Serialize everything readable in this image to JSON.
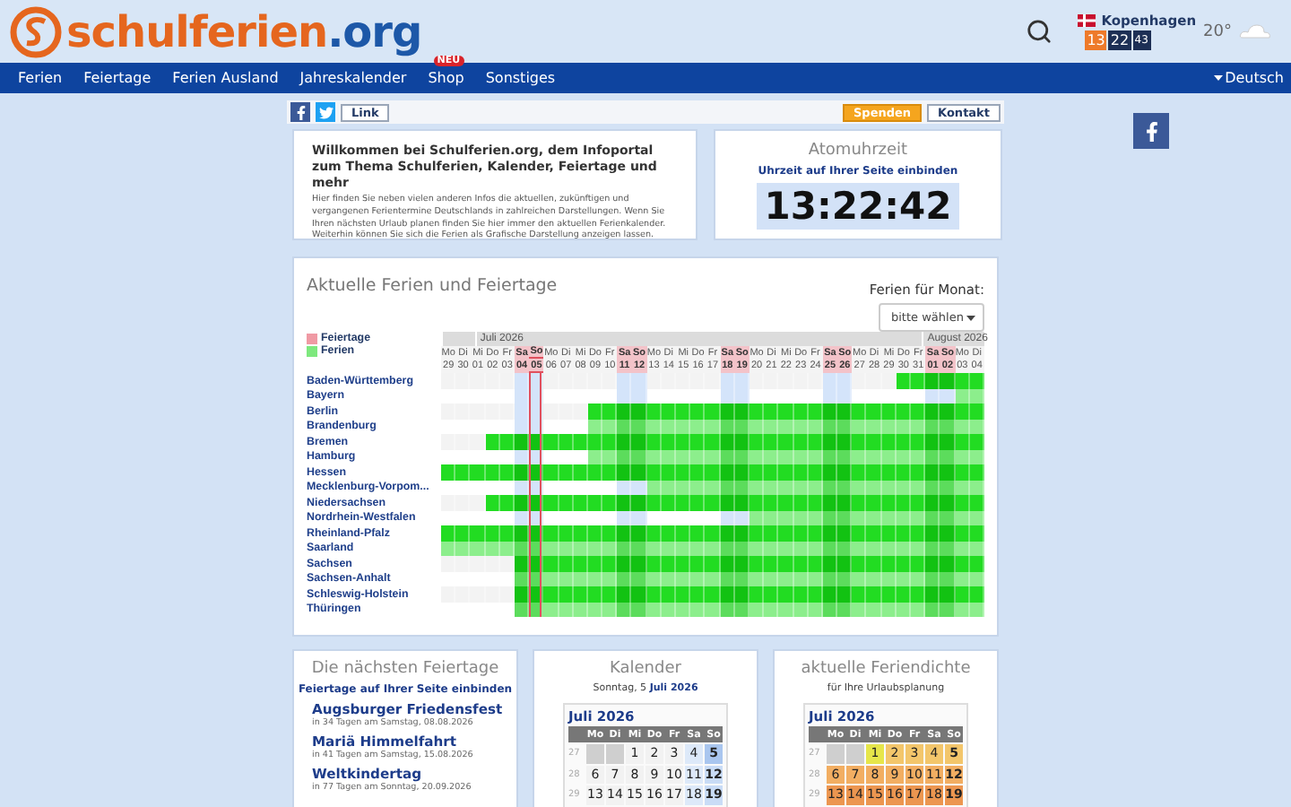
{
  "header": {
    "logo_name": "schulferien",
    "logo_tld": ".org",
    "weather": {
      "city": "Kopenhagen",
      "hours": "13",
      "minutes": "22",
      "seconds": "43",
      "temperature": "20°"
    }
  },
  "nav": {
    "items": [
      {
        "label": "Ferien"
      },
      {
        "label": "Feiertage"
      },
      {
        "label": "Ferien Ausland"
      },
      {
        "label": "Jahreskalender"
      },
      {
        "label": "Shop",
        "badge": "NEU"
      },
      {
        "label": "Sonstiges"
      }
    ],
    "language": "Deutsch"
  },
  "toolbar": {
    "link": "Link",
    "donate": "Spenden",
    "contact": "Kontakt"
  },
  "welcome": {
    "title": "Willkommen bei Schulferien.org, dem Infoportal zum Thema Schulferien, Kalender, Feiertage und mehr",
    "text": "Hier finden Sie neben vielen anderen Infos die aktuellen, zukünftigen und vergangenen Ferientermine Deutschlands in zahlreichen Darstellungen. Wenn Sie Ihren nächsten Urlaub planen finden Sie hier immer den aktuellen Ferienkalender. Weiterhin können Sie sich die Ferien als Grafische Darstellung anzeigen lassen."
  },
  "clock": {
    "title": "Atomuhrzeit",
    "embed_link": "Uhrzeit auf Ihrer Seite einbinden",
    "time": "13:22:42"
  },
  "holidays_map": {
    "title": "Aktuelle Ferien und Feiertage",
    "month_label": "Ferien für Monat:",
    "month_select": {
      "placeholder": "bitte wählen"
    },
    "legend": [
      {
        "label": "Feiertage",
        "color": "#f09aa4"
      },
      {
        "label": "Ferien",
        "color": "#7ee87e"
      }
    ],
    "days": [
      {
        "weekday": "Mo",
        "day": "29",
        "weekend": false,
        "today": false
      },
      {
        "weekday": "Di",
        "day": "30",
        "weekend": false,
        "today": false
      },
      {
        "weekday": "Mi",
        "day": "01",
        "weekend": false,
        "today": false,
        "month_label": "Juli 2026"
      },
      {
        "weekday": "Do",
        "day": "02",
        "weekend": false,
        "today": false
      },
      {
        "weekday": "Fr",
        "day": "03",
        "weekend": false,
        "today": false
      },
      {
        "weekday": "Sa",
        "day": "04",
        "weekend": true,
        "today": false
      },
      {
        "weekday": "So",
        "day": "05",
        "weekend": true,
        "today": true
      },
      {
        "weekday": "Mo",
        "day": "06",
        "weekend": false,
        "today": false
      },
      {
        "weekday": "Di",
        "day": "07",
        "weekend": false,
        "today": false
      },
      {
        "weekday": "Mi",
        "day": "08",
        "weekend": false,
        "today": false
      },
      {
        "weekday": "Do",
        "day": "09",
        "weekend": false,
        "today": false
      },
      {
        "weekday": "Fr",
        "day": "10",
        "weekend": false,
        "today": false
      },
      {
        "weekday": "Sa",
        "day": "11",
        "weekend": true,
        "today": false
      },
      {
        "weekday": "So",
        "day": "12",
        "weekend": true,
        "today": false
      },
      {
        "weekday": "Mo",
        "day": "13",
        "weekend": false,
        "today": false
      },
      {
        "weekday": "Di",
        "day": "14",
        "weekend": false,
        "today": false
      },
      {
        "weekday": "Mi",
        "day": "15",
        "weekend": false,
        "today": false
      },
      {
        "weekday": "Do",
        "day": "16",
        "weekend": false,
        "today": false
      },
      {
        "weekday": "Fr",
        "day": "17",
        "weekend": false,
        "today": false
      },
      {
        "weekday": "Sa",
        "day": "18",
        "weekend": true,
        "today": false
      },
      {
        "weekday": "So",
        "day": "19",
        "weekend": true,
        "today": false
      },
      {
        "weekday": "Mo",
        "day": "20",
        "weekend": false,
        "today": false
      },
      {
        "weekday": "Di",
        "day": "21",
        "weekend": false,
        "today": false
      },
      {
        "weekday": "Mi",
        "day": "22",
        "weekend": false,
        "today": false
      },
      {
        "weekday": "Do",
        "day": "23",
        "weekend": false,
        "today": false
      },
      {
        "weekday": "Fr",
        "day": "24",
        "weekend": false,
        "today": false
      },
      {
        "weekday": "Sa",
        "day": "25",
        "weekend": true,
        "today": false
      },
      {
        "weekday": "So",
        "day": "26",
        "weekend": true,
        "today": false
      },
      {
        "weekday": "Mo",
        "day": "27",
        "weekend": false,
        "today": false
      },
      {
        "weekday": "Di",
        "day": "28",
        "weekend": false,
        "today": false
      },
      {
        "weekday": "Mi",
        "day": "29",
        "weekend": false,
        "today": false
      },
      {
        "weekday": "Do",
        "day": "30",
        "weekend": false,
        "today": false
      },
      {
        "weekday": "Fr",
        "day": "31",
        "weekend": false,
        "today": false
      },
      {
        "weekday": "Sa",
        "day": "01",
        "weekend": true,
        "today": false,
        "month_label": "August 2026"
      },
      {
        "weekday": "So",
        "day": "02",
        "weekend": true,
        "today": false
      },
      {
        "weekday": "Mo",
        "day": "03",
        "weekend": false,
        "today": false
      },
      {
        "weekday": "Di",
        "day": "04",
        "weekend": false,
        "today": false
      }
    ],
    "states": [
      {
        "name": "Baden-Württemberg",
        "ferien": [
          false,
          false,
          false,
          false,
          false,
          false,
          false,
          false,
          false,
          false,
          false,
          false,
          false,
          false,
          false,
          false,
          false,
          false,
          false,
          false,
          false,
          false,
          false,
          false,
          false,
          false,
          false,
          false,
          false,
          false,
          false,
          true,
          true,
          true,
          true,
          true,
          true
        ]
      },
      {
        "name": "Bayern",
        "ferien": [
          false,
          false,
          false,
          false,
          false,
          false,
          false,
          false,
          false,
          false,
          false,
          false,
          false,
          false,
          false,
          false,
          false,
          false,
          false,
          false,
          false,
          false,
          false,
          false,
          false,
          false,
          false,
          false,
          false,
          false,
          false,
          false,
          false,
          false,
          false,
          true,
          true
        ]
      },
      {
        "name": "Berlin",
        "ferien": [
          false,
          false,
          false,
          false,
          false,
          false,
          false,
          false,
          false,
          false,
          true,
          true,
          true,
          true,
          true,
          true,
          true,
          true,
          true,
          true,
          true,
          true,
          true,
          true,
          true,
          true,
          true,
          true,
          true,
          true,
          true,
          true,
          true,
          true,
          true,
          true,
          true
        ]
      },
      {
        "name": "Brandenburg",
        "ferien": [
          false,
          false,
          false,
          false,
          false,
          false,
          false,
          false,
          false,
          false,
          true,
          true,
          true,
          true,
          true,
          true,
          true,
          true,
          true,
          true,
          true,
          true,
          true,
          true,
          true,
          true,
          true,
          true,
          true,
          true,
          true,
          true,
          true,
          true,
          true,
          true,
          true
        ]
      },
      {
        "name": "Bremen",
        "ferien": [
          false,
          false,
          false,
          true,
          true,
          true,
          true,
          true,
          true,
          true,
          true,
          true,
          true,
          true,
          true,
          true,
          true,
          true,
          true,
          true,
          true,
          true,
          true,
          true,
          true,
          true,
          true,
          true,
          true,
          true,
          true,
          true,
          true,
          true,
          true,
          true,
          true
        ]
      },
      {
        "name": "Hamburg",
        "ferien": [
          false,
          false,
          false,
          false,
          false,
          false,
          false,
          false,
          false,
          false,
          true,
          true,
          true,
          true,
          true,
          true,
          true,
          true,
          true,
          true,
          true,
          true,
          true,
          true,
          true,
          true,
          true,
          true,
          true,
          true,
          true,
          true,
          true,
          true,
          true,
          true,
          true
        ]
      },
      {
        "name": "Hessen",
        "ferien": [
          true,
          true,
          true,
          true,
          true,
          true,
          true,
          true,
          true,
          true,
          true,
          true,
          true,
          true,
          true,
          true,
          true,
          true,
          true,
          true,
          true,
          true,
          true,
          true,
          true,
          true,
          true,
          true,
          true,
          true,
          true,
          true,
          true,
          true,
          true,
          true,
          true
        ]
      },
      {
        "name": "Mecklenburg-Vorpom...",
        "ferien": [
          false,
          false,
          false,
          false,
          false,
          false,
          false,
          false,
          false,
          false,
          false,
          false,
          false,
          false,
          true,
          true,
          true,
          true,
          true,
          true,
          true,
          true,
          true,
          true,
          true,
          true,
          true,
          true,
          true,
          true,
          true,
          true,
          true,
          true,
          true,
          true,
          true
        ]
      },
      {
        "name": "Niedersachsen",
        "ferien": [
          false,
          false,
          false,
          true,
          true,
          true,
          true,
          true,
          true,
          true,
          true,
          true,
          true,
          true,
          true,
          true,
          true,
          true,
          true,
          true,
          true,
          true,
          true,
          true,
          true,
          true,
          true,
          true,
          true,
          true,
          true,
          true,
          true,
          true,
          true,
          true,
          true
        ]
      },
      {
        "name": "Nordrhein-Westfalen",
        "ferien": [
          false,
          false,
          false,
          false,
          false,
          false,
          false,
          false,
          false,
          false,
          false,
          false,
          false,
          false,
          false,
          false,
          false,
          false,
          false,
          false,
          false,
          true,
          true,
          true,
          true,
          true,
          true,
          true,
          true,
          true,
          true,
          true,
          true,
          true,
          true,
          true,
          true
        ]
      },
      {
        "name": "Rheinland-Pfalz",
        "ferien": [
          true,
          true,
          true,
          true,
          true,
          true,
          true,
          true,
          true,
          true,
          true,
          true,
          true,
          true,
          true,
          true,
          true,
          true,
          true,
          true,
          true,
          true,
          true,
          true,
          true,
          true,
          true,
          true,
          true,
          true,
          true,
          true,
          true,
          true,
          true,
          true,
          true
        ]
      },
      {
        "name": "Saarland",
        "ferien": [
          true,
          true,
          true,
          true,
          true,
          true,
          true,
          true,
          true,
          true,
          true,
          true,
          true,
          true,
          true,
          true,
          true,
          true,
          true,
          true,
          true,
          true,
          true,
          true,
          true,
          true,
          true,
          true,
          true,
          true,
          true,
          true,
          true,
          true,
          true,
          true,
          true
        ]
      },
      {
        "name": "Sachsen",
        "ferien": [
          false,
          false,
          false,
          false,
          false,
          true,
          true,
          true,
          true,
          true,
          true,
          true,
          true,
          true,
          true,
          true,
          true,
          true,
          true,
          true,
          true,
          true,
          true,
          true,
          true,
          true,
          true,
          true,
          true,
          true,
          true,
          true,
          true,
          true,
          true,
          true,
          true
        ]
      },
      {
        "name": "Sachsen-Anhalt",
        "ferien": [
          false,
          false,
          false,
          false,
          false,
          true,
          true,
          true,
          true,
          true,
          true,
          true,
          true,
          true,
          true,
          true,
          true,
          true,
          true,
          true,
          true,
          true,
          true,
          true,
          true,
          true,
          true,
          true,
          true,
          true,
          true,
          true,
          true,
          true,
          true,
          true,
          true
        ]
      },
      {
        "name": "Schleswig-Holstein",
        "ferien": [
          false,
          false,
          false,
          false,
          false,
          true,
          true,
          true,
          true,
          true,
          true,
          true,
          true,
          true,
          true,
          true,
          true,
          true,
          true,
          true,
          true,
          true,
          true,
          true,
          true,
          true,
          true,
          true,
          true,
          true,
          true,
          true,
          true,
          true,
          true,
          true,
          true
        ]
      },
      {
        "name": "Thüringen",
        "ferien": [
          false,
          false,
          false,
          false,
          false,
          true,
          true,
          true,
          true,
          true,
          true,
          true,
          true,
          true,
          true,
          true,
          true,
          true,
          true,
          true,
          true,
          true,
          true,
          true,
          true,
          true,
          true,
          true,
          true,
          true,
          true,
          true,
          true,
          true,
          true,
          true,
          true
        ]
      }
    ]
  },
  "next_holidays": {
    "title": "Die nächsten Feiertage",
    "embed_link": "Feiertage auf Ihrer Seite einbinden",
    "items": [
      {
        "name": "Augsburger Friedensfest",
        "detail": "in 34 Tagen am Samstag, 08.08.2026"
      },
      {
        "name": "Mariä Himmelfahrt",
        "detail": "in 41 Tagen am Samstag, 15.08.2026"
      },
      {
        "name": "Weltkindertag",
        "detail": "in 77 Tagen am Sonntag, 20.09.2026"
      }
    ]
  },
  "calendar": {
    "title": "Kalender",
    "date": "Sonntag, 5 **Juli 2026**",
    "month": "Juli 2026",
    "weekdays": [
      "Mo",
      "Di",
      "Mi",
      "Do",
      "Fr",
      "Sa",
      "So"
    ],
    "weeks": [
      {
        "number": "27",
        "days": [
          {
            "kind": "blank"
          },
          {
            "kind": "blank"
          },
          {
            "kind": "day",
            "label": "1",
            "weekend": false,
            "selected": false
          },
          {
            "kind": "day",
            "label": "2",
            "weekend": false,
            "selected": false
          },
          {
            "kind": "day",
            "label": "3",
            "weekend": false,
            "selected": false
          },
          {
            "kind": "day",
            "label": "4",
            "weekend": true,
            "selected": false
          },
          {
            "kind": "day",
            "label": "5",
            "weekend": true,
            "selected": true
          }
        ]
      },
      {
        "number": "28",
        "days": [
          {
            "kind": "day",
            "label": "6",
            "weekend": false,
            "selected": false
          },
          {
            "kind": "day",
            "label": "7",
            "weekend": false,
            "selected": false
          },
          {
            "kind": "day",
            "label": "8",
            "weekend": false,
            "selected": false
          },
          {
            "kind": "day",
            "label": "9",
            "weekend": false,
            "selected": false
          },
          {
            "kind": "day",
            "label": "10",
            "weekend": false,
            "selected": false
          },
          {
            "kind": "day",
            "label": "11",
            "weekend": true,
            "selected": false
          },
          {
            "kind": "day",
            "label": "12",
            "weekend": true,
            "selected": false
          }
        ]
      },
      {
        "number": "29",
        "days": [
          {
            "kind": "day",
            "label": "13",
            "weekend": false,
            "selected": false
          },
          {
            "kind": "day",
            "label": "14",
            "weekend": false,
            "selected": false
          },
          {
            "kind": "day",
            "label": "15",
            "weekend": false,
            "selected": false
          },
          {
            "kind": "day",
            "label": "16",
            "weekend": false,
            "selected": false
          },
          {
            "kind": "day",
            "label": "17",
            "weekend": false,
            "selected": false
          },
          {
            "kind": "day",
            "label": "18",
            "weekend": true,
            "selected": false
          },
          {
            "kind": "day",
            "label": "19",
            "weekend": true,
            "selected": false
          }
        ]
      }
    ]
  },
  "density": {
    "title": "aktuelle Feriendichte",
    "subtitle": "für Ihre Urlaubsplanung",
    "month": "Juli 2026",
    "weekdays": [
      "Mo",
      "Di",
      "Mi",
      "Do",
      "Fr",
      "Sa",
      "So"
    ],
    "weeks": [
      {
        "number": "27",
        "days": [
          {
            "kind": "blank"
          },
          {
            "kind": "blank"
          },
          {
            "kind": "day",
            "label": "1",
            "color": "#e6e64a"
          },
          {
            "kind": "day",
            "label": "2",
            "color": "#f3c66b"
          },
          {
            "kind": "day",
            "label": "3",
            "color": "#f3c66b"
          },
          {
            "kind": "day",
            "label": "4",
            "color": "#f3c66b"
          },
          {
            "kind": "day",
            "label": "5",
            "color": "#f3c66b"
          }
        ]
      },
      {
        "number": "28",
        "days": [
          {
            "kind": "day",
            "label": "6",
            "color": "#f2ae62"
          },
          {
            "kind": "day",
            "label": "7",
            "color": "#f2ae62"
          },
          {
            "kind": "day",
            "label": "8",
            "color": "#f2ae62"
          },
          {
            "kind": "day",
            "label": "9",
            "color": "#f2ae62"
          },
          {
            "kind": "day",
            "label": "10",
            "color": "#f2ae62"
          },
          {
            "kind": "day",
            "label": "11",
            "color": "#f2ae62"
          },
          {
            "kind": "day",
            "label": "12",
            "color": "#f2ae62"
          }
        ]
      },
      {
        "number": "29",
        "days": [
          {
            "kind": "day",
            "label": "13",
            "color": "#ec9650"
          },
          {
            "kind": "day",
            "label": "14",
            "color": "#ec9650"
          },
          {
            "kind": "day",
            "label": "15",
            "color": "#ec9650"
          },
          {
            "kind": "day",
            "label": "16",
            "color": "#ec9650"
          },
          {
            "kind": "day",
            "label": "17",
            "color": "#ec9650"
          },
          {
            "kind": "day",
            "label": "18",
            "color": "#ec9650"
          },
          {
            "kind": "day",
            "label": "19",
            "color": "#ec9650"
          }
        ]
      }
    ]
  }
}
